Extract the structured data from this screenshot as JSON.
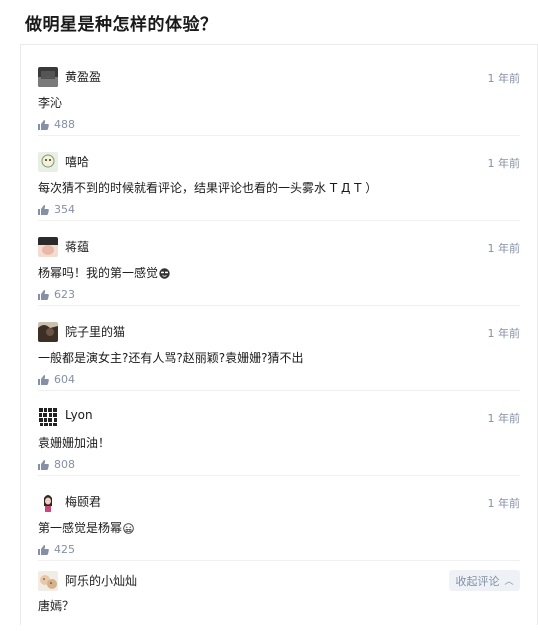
{
  "page": {
    "title": "做明星是种怎样的体验？"
  },
  "comments": [
    {
      "author": "黄盈盈",
      "time": "1 年前",
      "content": "李沁",
      "likes": "488"
    },
    {
      "author": "嘻哈",
      "time": "1 年前",
      "content": "每次猜不到的时候就看评论，结果评论也看的一头雾水 T Д T ）",
      "likes": "354"
    },
    {
      "author": "蒋蕴",
      "time": "1 年前",
      "content": "杨幂吗！我的第一感觉",
      "likes": "623"
    },
    {
      "author": "院子里的猫",
      "time": "1 年前",
      "content": "一般都是演女主?还有人骂?赵丽颖?袁姗姗?猜不出",
      "likes": "604"
    },
    {
      "author": "Lyon",
      "time": "1 年前",
      "content": "袁姗姗加油！",
      "likes": "808"
    },
    {
      "author": "梅颐君",
      "time": "1 年前",
      "content": "第一感觉是杨幂",
      "likes": "425"
    },
    {
      "author": "阿乐的小灿灿",
      "content": "唐嫣？"
    }
  ],
  "actions": {
    "collapse_label": "收起评论"
  },
  "icons": {
    "like": "thumbs-up-icon",
    "chevron": "chevron-up-icon",
    "emoji_a": "cool-face-emoji-icon",
    "emoji_b": "grimace-face-emoji-icon"
  },
  "colors": {
    "meta": "#8590a6",
    "text": "#1a1a1a",
    "button_bg": "#eef2f6"
  }
}
